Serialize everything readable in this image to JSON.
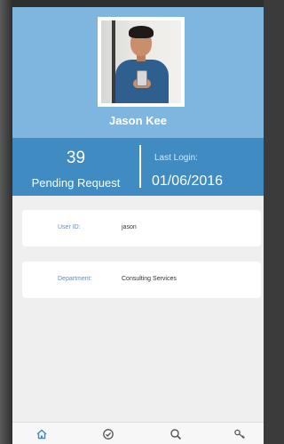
{
  "profile": {
    "name": "Jason Kee"
  },
  "stats": {
    "pending_count": "39",
    "pending_label": "Pending Request",
    "last_login_label": "Last Login:",
    "last_login_value": "01/06/2016"
  },
  "details": {
    "user_id_label": "User ID:",
    "user_id_value": "jason",
    "department_label": "Department:",
    "department_value": "Consulting Services"
  },
  "tabbar": {
    "icons": [
      "home-icon",
      "check-circle-icon",
      "search-icon",
      "key-icon"
    ]
  },
  "colors": {
    "profile_bg": "#7eb6e0",
    "stats_bg": "#3f8bc2",
    "accent": "#3f8bc2"
  }
}
